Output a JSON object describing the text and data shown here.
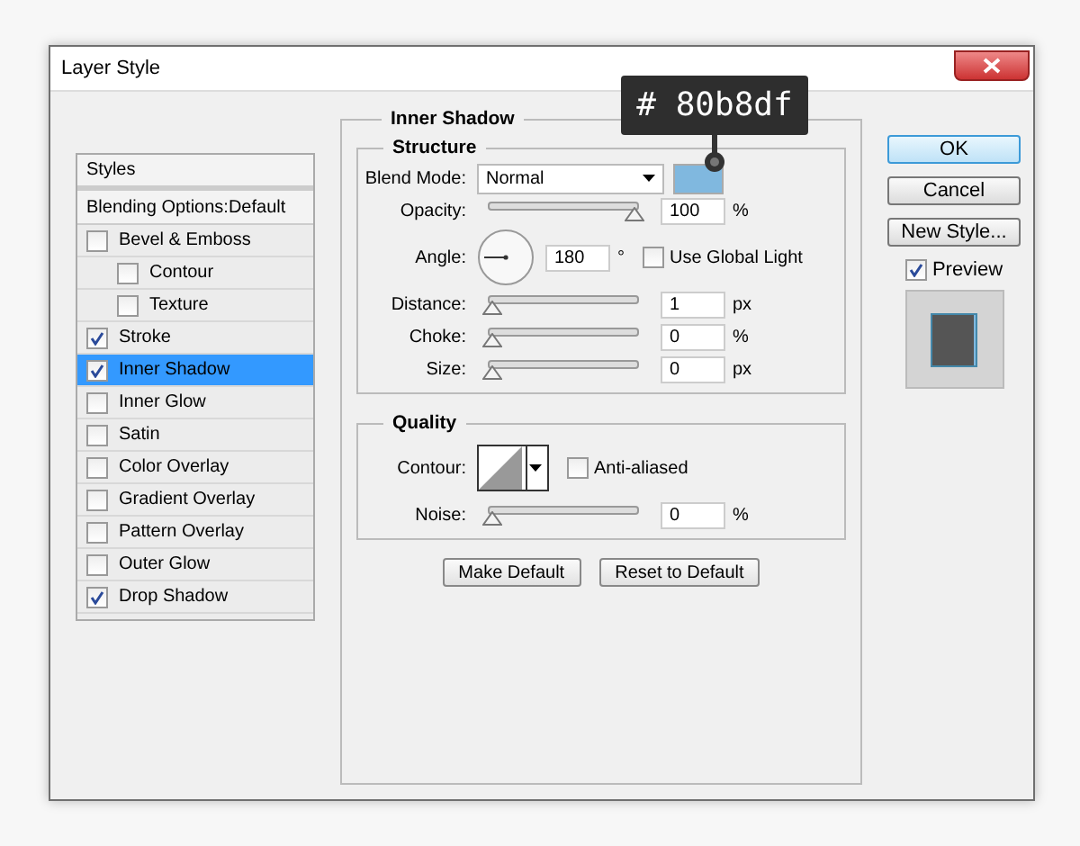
{
  "window": {
    "title": "Layer Style"
  },
  "styles": {
    "header": "Styles",
    "blending_options": "Blending Options:Default",
    "items": [
      {
        "label": "Bevel & Emboss",
        "checked": false,
        "selected": false,
        "children": [
          {
            "label": "Contour",
            "checked": false,
            "selected": false
          },
          {
            "label": "Texture",
            "checked": false,
            "selected": false
          }
        ]
      },
      {
        "label": "Stroke",
        "checked": true,
        "selected": false
      },
      {
        "label": "Inner Shadow",
        "checked": true,
        "selected": true
      },
      {
        "label": "Inner Glow",
        "checked": false,
        "selected": false
      },
      {
        "label": "Satin",
        "checked": false,
        "selected": false
      },
      {
        "label": "Color Overlay",
        "checked": false,
        "selected": false
      },
      {
        "label": "Gradient Overlay",
        "checked": false,
        "selected": false
      },
      {
        "label": "Pattern Overlay",
        "checked": false,
        "selected": false
      },
      {
        "label": "Outer Glow",
        "checked": false,
        "selected": false
      },
      {
        "label": "Drop Shadow",
        "checked": true,
        "selected": false
      }
    ]
  },
  "panel": {
    "title": "Inner Shadow",
    "structure": {
      "title": "Structure",
      "rows": [
        {
          "kind": "blend",
          "label": "Blend Mode:",
          "value": "Normal",
          "color": "#80b8df",
          "tooltip": "# 80b8df"
        },
        {
          "kind": "slider",
          "label": "Opacity:",
          "level": 1,
          "value": "100",
          "unit": "%"
        },
        {
          "kind": "angle",
          "label": "Angle:",
          "value": "180",
          "unit": "°",
          "option": {
            "label": "Use Global Light",
            "checked": false
          }
        },
        {
          "kind": "slider",
          "label": "Distance:",
          "level": 0,
          "value": "1",
          "unit": "px"
        },
        {
          "kind": "slider",
          "label": "Choke:",
          "level": 0,
          "value": "0",
          "unit": "%"
        },
        {
          "kind": "slider",
          "label": "Size:",
          "level": 0,
          "value": "0",
          "unit": "px"
        }
      ]
    },
    "quality": {
      "title": "Quality",
      "rows": [
        {
          "kind": "contour",
          "label": "Contour:",
          "option": {
            "label": "Anti-aliased",
            "checked": false
          }
        },
        {
          "kind": "slider",
          "label": "Noise:",
          "level": 0,
          "value": "0",
          "unit": "%"
        }
      ]
    },
    "buttons": [
      "Make Default",
      "Reset to Default"
    ]
  },
  "actions": {
    "buttons": [
      {
        "label": "OK",
        "default": true
      },
      {
        "label": "Cancel",
        "default": false
      },
      {
        "label": "New Style...",
        "default": false
      }
    ],
    "preview": {
      "label": "Preview",
      "checked": true
    }
  }
}
